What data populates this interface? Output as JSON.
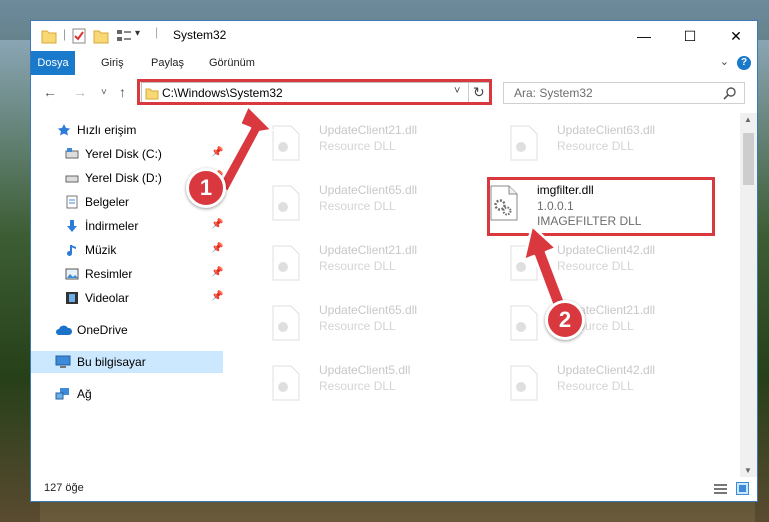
{
  "window": {
    "title": "System32"
  },
  "controls": {
    "minimize": "—",
    "maximize": "☐",
    "close": "✕"
  },
  "ribbon": {
    "tabs": [
      "Dosya",
      "Giriş",
      "Paylaş",
      "Görünüm"
    ],
    "active_tab": "Dosya",
    "help": "?"
  },
  "navigation": {
    "back": "←",
    "forward": "→",
    "recent": "˅",
    "up": "↑"
  },
  "address": {
    "path": "C:\\Windows\\System32",
    "dropdown": "˅",
    "refresh": "↻"
  },
  "search": {
    "placeholder": "Ara: System32"
  },
  "sidebar": {
    "items": [
      {
        "label": "Hızlı erişim",
        "icon": "star-icon",
        "pinned": false
      },
      {
        "label": "Yerel Disk (C:)",
        "icon": "drive-icon",
        "pinned": true
      },
      {
        "label": "Yerel Disk (D:)",
        "icon": "drive-icon",
        "pinned": true
      },
      {
        "label": "Belgeler",
        "icon": "documents-icon",
        "pinned": true
      },
      {
        "label": "İndirmeler",
        "icon": "download-icon",
        "pinned": true
      },
      {
        "label": "Müzik",
        "icon": "music-icon",
        "pinned": true
      },
      {
        "label": "Resimler",
        "icon": "pictures-icon",
        "pinned": true
      },
      {
        "label": "Videolar",
        "icon": "video-icon",
        "pinned": true
      },
      {
        "label": "OneDrive",
        "icon": "cloud-icon",
        "pinned": false
      },
      {
        "label": "Bu bilgisayar",
        "icon": "computer-icon",
        "pinned": false,
        "selected": true
      },
      {
        "label": "Ağ",
        "icon": "network-icon",
        "pinned": false
      }
    ],
    "pin_glyph": "📌"
  },
  "files": [
    {
      "name": "UpdateClient21.dll",
      "desc": "Resource DLL"
    },
    {
      "name": "UpdateClient63.dll",
      "desc": "Resource DLL"
    },
    {
      "name": "UpdateClient65.dll",
      "desc": "Resource DLL"
    },
    {
      "name": "imgfilter.dll",
      "version": "1.0.0.1",
      "desc": "IMAGEFILTER DLL",
      "highlighted": true
    },
    {
      "name": "UpdateClient21.dll",
      "desc": "Resource DLL"
    },
    {
      "name": "UpdateClient42.dll",
      "desc": "Resource DLL"
    },
    {
      "name": "UpdateClient65.dll",
      "desc": "Resource DLL"
    },
    {
      "name": "UpdateClient21.dll",
      "desc": "Resource DLL"
    },
    {
      "name": "UpdateClient5.dll",
      "desc": "Resource DLL"
    },
    {
      "name": "UpdateClient42.dll",
      "desc": "Resource DLL"
    }
  ],
  "status": {
    "item_count": "127 öğe"
  },
  "annotations": {
    "step1": "1",
    "step2": "2",
    "color": "#d9383e"
  }
}
